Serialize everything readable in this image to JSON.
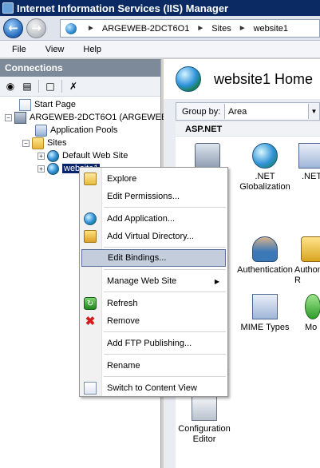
{
  "window": {
    "title": "Internet Information Services (IIS) Manager"
  },
  "navigation": {
    "back_icon": "back-arrow-icon",
    "forward_icon": "forward-arrow-icon",
    "breadcrumb": [
      "ARGEWEB-2DCT6O1",
      "Sites",
      "website1"
    ]
  },
  "menu": [
    "File",
    "View",
    "Help"
  ],
  "connections": {
    "title": "Connections",
    "toolbar_icons": [
      "connect-icon",
      "save-icon",
      "folder-up-icon",
      "disconnect-icon"
    ],
    "tree": {
      "start_page": "Start Page",
      "server": "ARGEWEB-2DCT6O1 (ARGEWEB",
      "app_pools": "Application Pools",
      "sites": "Sites",
      "default_site": "Default Web Site",
      "website1": "website1"
    }
  },
  "home": {
    "title": "website1 Home",
    "group_by_label": "Group by:",
    "group_by_value": "Area",
    "group_aspnet": "ASP.NET",
    "group_management": "ment",
    "features": {
      "net_globalization": ".NET\nGlobalization",
      "net_partial": ".NET",
      "authentication": "Authentication",
      "auth_partial": "Authon\nR",
      "mime_types": "MIME Types",
      "mo_partial": "Mo",
      "configuration_editor": "Configuration\nEditor"
    }
  },
  "context_menu": {
    "explore": "Explore",
    "edit_permissions": "Edit Permissions...",
    "add_application": "Add Application...",
    "add_virtual_directory": "Add Virtual Directory...",
    "edit_bindings": "Edit Bindings...",
    "manage_web_site": "Manage Web Site",
    "refresh": "Refresh",
    "remove": "Remove",
    "add_ftp_publishing": "Add FTP Publishing...",
    "rename": "Rename",
    "switch_to_content_view": "Switch to Content View"
  }
}
